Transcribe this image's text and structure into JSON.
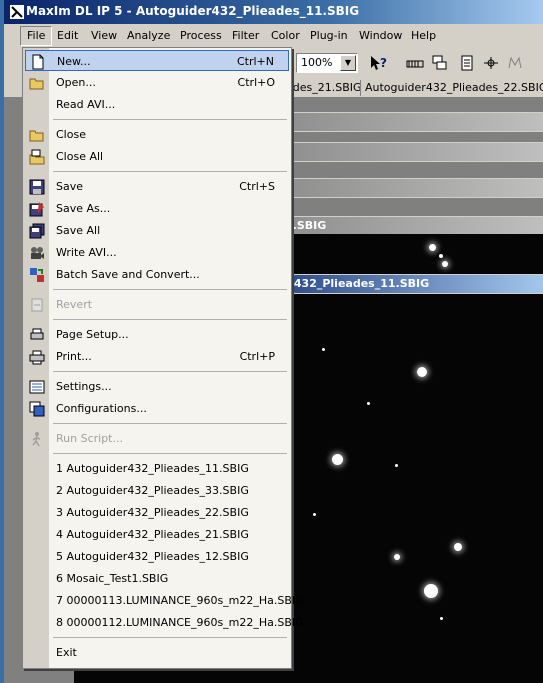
{
  "app": {
    "title": "MaxIm DL IP 5 - Autoguider432_Plieades_11.SBIG"
  },
  "menubar": {
    "items": [
      "File",
      "Edit",
      "View",
      "Analyze",
      "Process",
      "Filter",
      "Color",
      "Plug-in",
      "Window",
      "Help"
    ]
  },
  "toolbar": {
    "zoom": "100%"
  },
  "tabs": {
    "items": [
      "ades_21.SBIG",
      "Autoguider432_Plieades_22.SBIG"
    ]
  },
  "windows": {
    "w3_title": "3.SBIG",
    "active_title": "er432_Plieades_11.SBIG"
  },
  "file_menu": {
    "new": {
      "label": "New...",
      "shortcut": "Ctrl+N"
    },
    "open": {
      "label": "Open...",
      "shortcut": "Ctrl+O"
    },
    "read_avi": {
      "label": "Read AVI..."
    },
    "close": {
      "label": "Close"
    },
    "close_all": {
      "label": "Close All"
    },
    "save": {
      "label": "Save",
      "shortcut": "Ctrl+S"
    },
    "save_as": {
      "label": "Save As..."
    },
    "save_all": {
      "label": "Save All"
    },
    "write_avi": {
      "label": "Write AVI..."
    },
    "batch_save": {
      "label": "Batch Save and Convert..."
    },
    "revert": {
      "label": "Revert"
    },
    "page_setup": {
      "label": "Page Setup..."
    },
    "print": {
      "label": "Print...",
      "shortcut": "Ctrl+P"
    },
    "settings": {
      "label": "Settings..."
    },
    "configurations": {
      "label": "Configurations..."
    },
    "run_script": {
      "label": "Run Script..."
    },
    "recent": [
      "1 Autoguider432_Plieades_11.SBIG",
      "2 Autoguider432_Plieades_33.SBIG",
      "3 Autoguider432_Plieades_22.SBIG",
      "4 Autoguider432_Plieades_21.SBIG",
      "5 Autoguider432_Plieades_12.SBIG",
      "6 Mosaic_Test1.SBIG",
      "7 00000113.LUMINANCE_960s_m22_Ha.SBIG",
      "8 00000112.LUMINANCE_960s_m22_Ha.SBIG"
    ],
    "exit": {
      "label": "Exit"
    }
  }
}
